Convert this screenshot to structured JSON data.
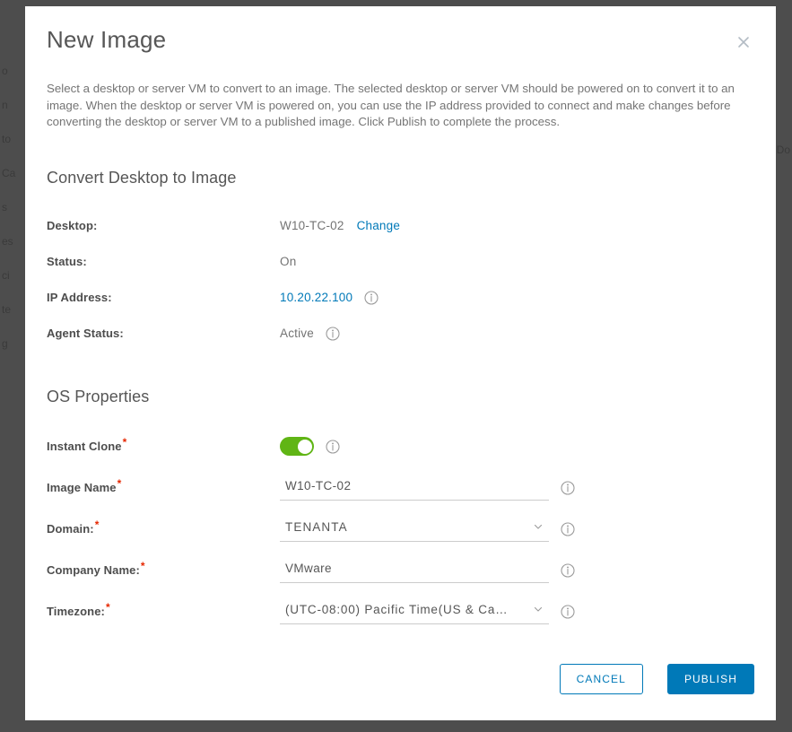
{
  "backdrop": {
    "left_fragments": [
      "o",
      "n",
      "to",
      "Ca",
      "s",
      "es",
      "ci",
      "te",
      "g"
    ],
    "right_fragments": [
      "Do"
    ]
  },
  "dialog": {
    "title": "New Image",
    "close_icon": "close-icon",
    "description": "Select a desktop or server VM to convert to an image. The selected desktop or server VM should be powered on to convert it to an image. When the desktop or server VM is powered on, you can use the IP address provided to connect and make changes before converting the desktop or server VM to a published image. Click Publish to complete the process.",
    "sections": {
      "convert": {
        "heading": "Convert Desktop to Image",
        "rows": [
          {
            "label": "Desktop:",
            "value": "W10-TC-02",
            "action_label": "Change",
            "has_info": false,
            "is_link": false
          },
          {
            "label": "Status:",
            "value": "On",
            "has_info": false,
            "is_link": false
          },
          {
            "label": "IP Address:",
            "value": "10.20.22.100",
            "has_info": true,
            "is_link": true
          },
          {
            "label": "Agent Status:",
            "value": "Active",
            "has_info": true,
            "is_link": false
          }
        ]
      },
      "os_properties": {
        "heading": "OS Properties",
        "fields": {
          "instant_clone": {
            "label": "Instant Clone",
            "required": true,
            "type": "toggle",
            "value": "on",
            "has_info": true
          },
          "image_name": {
            "label": "Image Name",
            "required": true,
            "type": "text",
            "value": "W10-TC-02",
            "placeholder": "",
            "has_info": true
          },
          "domain": {
            "label": "Domain:",
            "required": true,
            "type": "select",
            "value": "TENANTA",
            "has_info": true
          },
          "company_name": {
            "label": "Company Name:",
            "required": true,
            "type": "text",
            "value": "VMware",
            "placeholder": "",
            "has_info": true
          },
          "timezone": {
            "label": "Timezone:",
            "required": true,
            "type": "select",
            "value": "(UTC-08:00) Pacific Time(US & Ca…",
            "has_info": true
          }
        }
      }
    },
    "footer": {
      "cancel_label": "CANCEL",
      "publish_label": "PUBLISH"
    }
  },
  "colors": {
    "accent_blue": "#0079b8",
    "toggle_green": "#60b515",
    "required_red": "#e62700",
    "label_gray": "#4d4d4d",
    "value_gray": "#737373",
    "heading_gray": "#565656",
    "backdrop": "#4d4d4d"
  }
}
